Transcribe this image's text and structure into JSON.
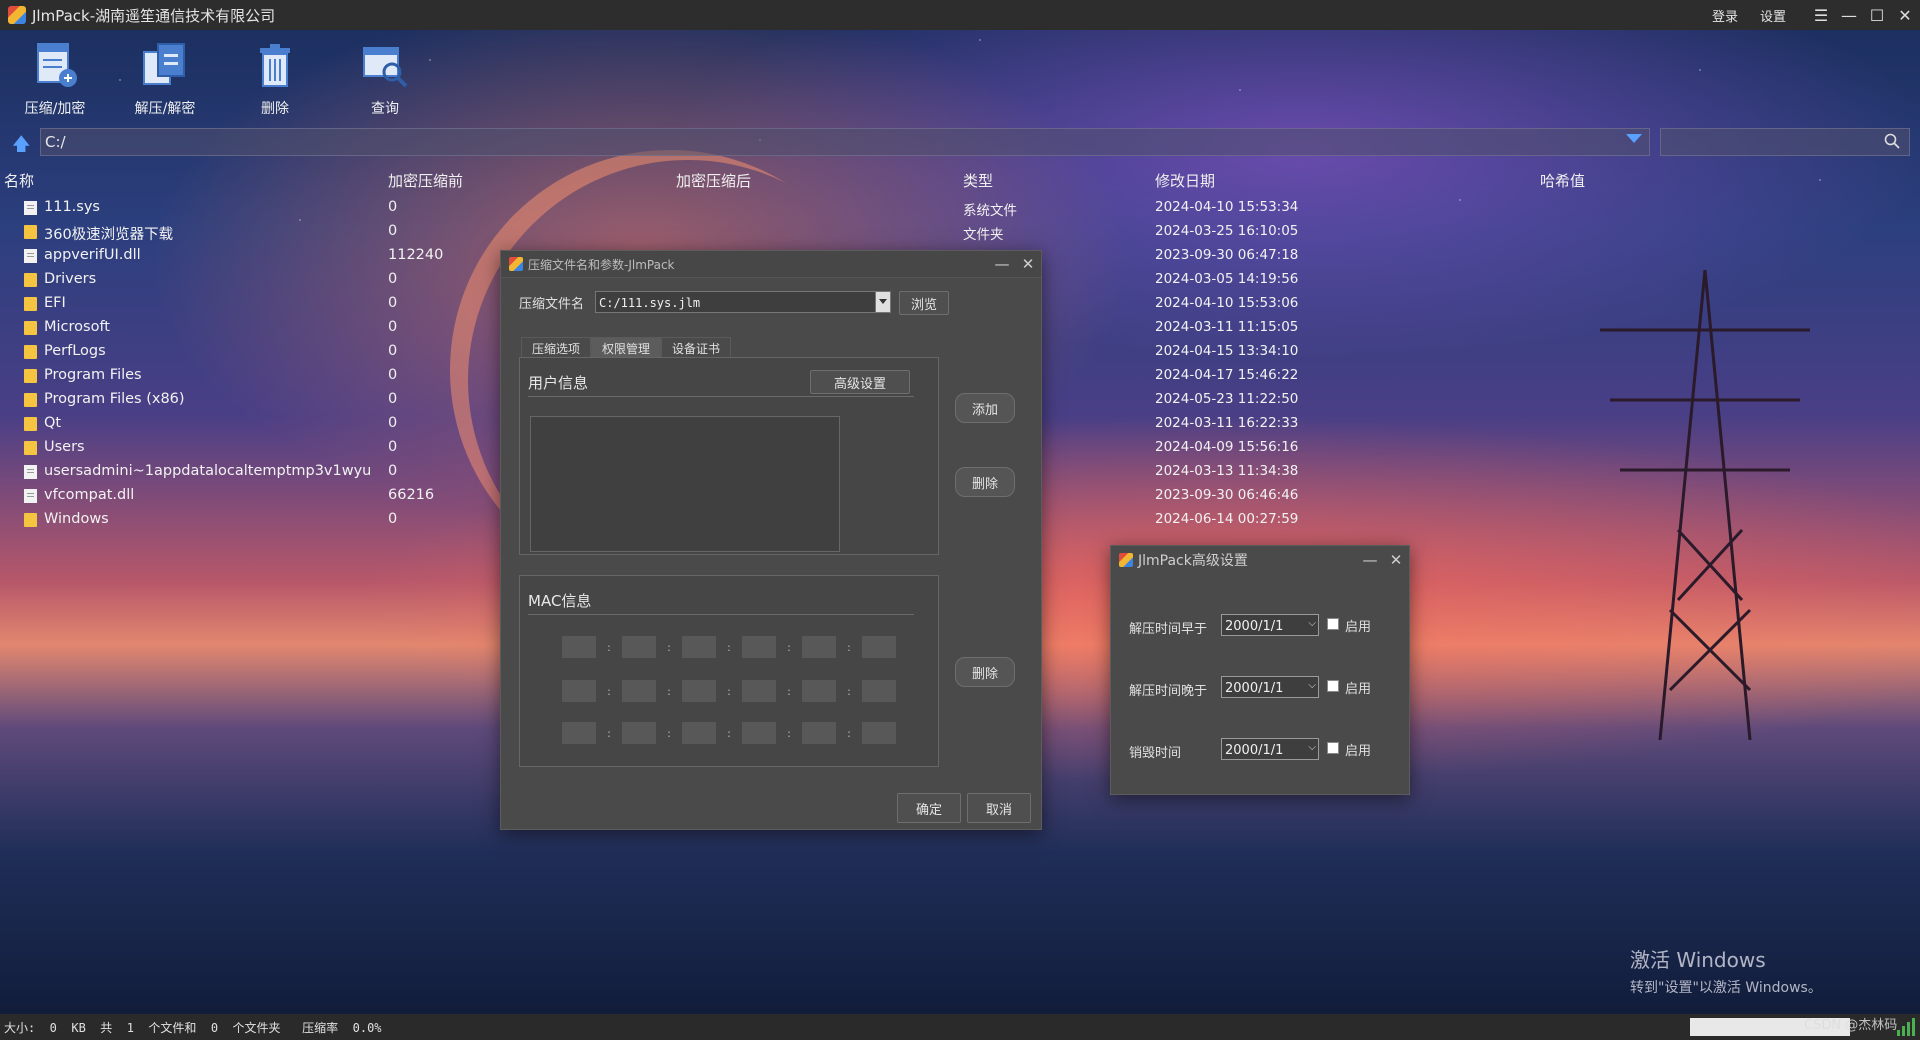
{
  "window": {
    "title": "JlmPack-湖南遥笙通信技术有限公司",
    "login": "登录",
    "settings": "设置"
  },
  "toolbar": {
    "compress": "压缩/加密",
    "decompress": "解压/解密",
    "delete": "删除",
    "query": "查询"
  },
  "path": {
    "value": "C:/"
  },
  "columns": {
    "name": "名称",
    "before": "加密压缩前",
    "after": "加密压缩后",
    "type": "类型",
    "modified": "修改日期",
    "hash": "哈希值"
  },
  "files": [
    {
      "name": "111.sys",
      "size": "0",
      "kind": "file",
      "type": "系统文件",
      "date": "2024-04-10 15:53:34"
    },
    {
      "name": "360极速浏览器下载",
      "size": "0",
      "kind": "folder",
      "type": "文件夹",
      "date": "2024-03-25 16:10:05"
    },
    {
      "name": "appverifUI.dll",
      "size": "112240",
      "kind": "file",
      "type": "",
      "date": "2023-09-30 06:47:18"
    },
    {
      "name": "Drivers",
      "size": "0",
      "kind": "folder",
      "type": "",
      "date": "2024-03-05 14:19:56"
    },
    {
      "name": "EFI",
      "size": "0",
      "kind": "folder",
      "type": "",
      "date": "2024-04-10 15:53:06"
    },
    {
      "name": "Microsoft",
      "size": "0",
      "kind": "folder",
      "type": "",
      "date": "2024-03-11 11:15:05"
    },
    {
      "name": "PerfLogs",
      "size": "0",
      "kind": "folder",
      "type": "",
      "date": "2024-04-15 13:34:10"
    },
    {
      "name": "Program Files",
      "size": "0",
      "kind": "folder",
      "type": "",
      "date": "2024-04-17 15:46:22"
    },
    {
      "name": "Program Files (x86)",
      "size": "0",
      "kind": "folder",
      "type": "",
      "date": "2024-05-23 11:22:50"
    },
    {
      "name": "Qt",
      "size": "0",
      "kind": "folder",
      "type": "",
      "date": "2024-03-11 16:22:33"
    },
    {
      "name": "Users",
      "size": "0",
      "kind": "folder",
      "type": "",
      "date": "2024-04-09 15:56:16"
    },
    {
      "name": "usersadmini~1appdatalocaltemptmp3v1wyu",
      "size": "0",
      "kind": "file",
      "type": "",
      "date": "2024-03-13 11:34:38"
    },
    {
      "name": "vfcompat.dll",
      "size": "66216",
      "kind": "file",
      "type": "",
      "date": "2023-09-30 06:46:46"
    },
    {
      "name": "Windows",
      "size": "0",
      "kind": "folder",
      "type": "",
      "date": "2024-06-14 00:27:59"
    }
  ],
  "status": {
    "text": "大小:  0  KB  共  1  个文件和  0  个文件夹   压缩率  0.0%"
  },
  "watermark": {
    "line1": "激活 Windows",
    "line2": "转到\"设置\"以激活 Windows。",
    "csdn": "CSDN @杰林码"
  },
  "dialog": {
    "title": "压缩文件名和参数-JlmPack",
    "file_label": "压缩文件名",
    "file_value": "C:/111.sys.jlm",
    "browse": "浏览",
    "tabs": [
      "压缩选项",
      "权限管理",
      "设备证书"
    ],
    "user_info": "用户信息",
    "advanced": "高级设置",
    "add": "添加",
    "delete1": "删除",
    "mac_info": "MAC信息",
    "delete2": "删除",
    "ok": "确定",
    "cancel": "取消"
  },
  "advanced": {
    "title": "JlmPack高级设置",
    "rows": [
      {
        "label": "解压时间早于",
        "date": "2000/1/1",
        "enable": "启用"
      },
      {
        "label": "解压时间晚于",
        "date": "2000/1/1",
        "enable": "启用"
      },
      {
        "label": "销毁时间",
        "date": "2000/1/1",
        "enable": "启用"
      }
    ]
  }
}
